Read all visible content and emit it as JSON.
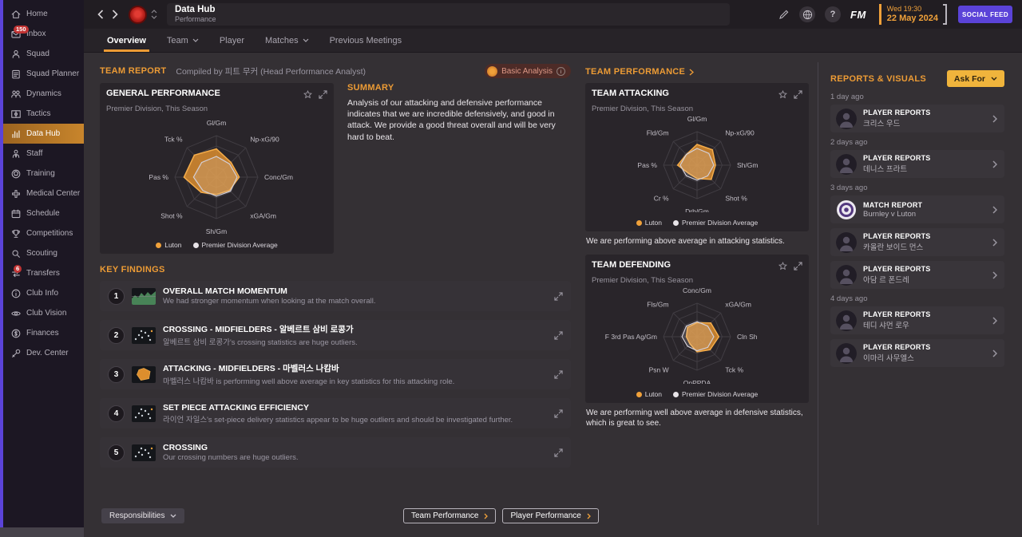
{
  "colors": {
    "accent_orange": "#ec9b35",
    "luton_series": "#f0a13a",
    "average_series": "#e8e4e8",
    "social_feed_purple": "#5b43d8",
    "ask_for_yellow": "#f0b43c",
    "sidebar_active": "#c8852c"
  },
  "sidebar": {
    "items": [
      {
        "label": "Home",
        "icon": "home"
      },
      {
        "label": "Inbox",
        "icon": "inbox",
        "badge": "150"
      },
      {
        "label": "Squad",
        "icon": "squad"
      },
      {
        "label": "Squad Planner",
        "icon": "planner"
      },
      {
        "label": "Dynamics",
        "icon": "dynamics"
      },
      {
        "label": "Tactics",
        "icon": "tactics"
      },
      {
        "label": "Data Hub",
        "icon": "datahub",
        "active": true
      },
      {
        "label": "Staff",
        "icon": "staff"
      },
      {
        "label": "Training",
        "icon": "training"
      },
      {
        "label": "Medical Center",
        "icon": "medical"
      },
      {
        "label": "Schedule",
        "icon": "schedule"
      },
      {
        "label": "Competitions",
        "icon": "competitions"
      },
      {
        "label": "Scouting",
        "icon": "scouting"
      },
      {
        "label": "Transfers",
        "icon": "transfers",
        "badge": "6"
      },
      {
        "label": "Club Info",
        "icon": "club-info"
      },
      {
        "label": "Club Vision",
        "icon": "club-vision"
      },
      {
        "label": "Finances",
        "icon": "finances"
      },
      {
        "label": "Dev. Center",
        "icon": "dev-center"
      }
    ]
  },
  "titlebar": {
    "title": "Data Hub",
    "subtitle": "Performance",
    "fm_label": "FM",
    "datetime_line1": "Wed 19:30",
    "datetime_line2": "22 May 2024",
    "social_feed_label": "SOCIAL FEED"
  },
  "tabs": [
    {
      "label": "Overview",
      "active": true
    },
    {
      "label": "Team",
      "dropdown": true
    },
    {
      "label": "Player"
    },
    {
      "label": "Matches",
      "dropdown": true
    },
    {
      "label": "Previous Meetings"
    }
  ],
  "report_header": {
    "title": "TEAM REPORT",
    "compiled_by": "Compiled by 피트 무커 (Head Performance Analyst)",
    "badge": "Basic Analysis"
  },
  "summary": {
    "title": "SUMMARY",
    "text": "Analysis of our attacking and defensive performance indicates that we are incredible defensively, and good in attack. We provide a good threat overall and will be very hard to beat."
  },
  "key_findings": {
    "title": "KEY FINDINGS",
    "items": [
      {
        "num": "1",
        "thumb": "momentum",
        "title": "OVERALL MATCH MOMENTUM",
        "desc": "We had stronger momentum when looking at the match overall."
      },
      {
        "num": "2",
        "thumb": "scatter",
        "title": "CROSSING - MIDFIELDERS - 알베르트 삼비 로콩가",
        "desc": "알베르트 삼비 로콩가's crossing statistics are huge outliers."
      },
      {
        "num": "3",
        "thumb": "radar",
        "title": "ATTACKING - MIDFIELDERS - 마벨러스 나캄바",
        "desc": "마벨러스 나캄바 is performing well above average in key statistics for this attacking role."
      },
      {
        "num": "4",
        "thumb": "scatter",
        "title": "SET PIECE ATTACKING EFFICIENCY",
        "desc": "라이언 자일스's set-piece delivery statistics appear to be huge outliers and should be investigated further."
      },
      {
        "num": "5",
        "thumb": "scatter",
        "title": "CROSSING",
        "desc": "Our crossing numbers are huge outliers."
      }
    ]
  },
  "team_performance": {
    "header": "TEAM PERFORMANCE",
    "attacking_note": "We are performing above average in attacking statistics.",
    "defending_note": "We are performing well above average in defensive statistics, which is great to see."
  },
  "chart_data": [
    {
      "type": "radar",
      "title": "GENERAL PERFORMANCE",
      "subtitle": "Premier Division, This Season",
      "axes": [
        "Gl/Gm",
        "Np-xG/90",
        "Conc/Gm",
        "xGA/Gm",
        "Sh/Gm",
        "Shot %",
        "Pas %",
        "Tck %"
      ],
      "scale": [
        0,
        1
      ],
      "grid": true,
      "legend_position": "bottom",
      "series": [
        {
          "name": "Luton",
          "color": "#f0a13a",
          "values": [
            0.68,
            0.5,
            0.55,
            0.45,
            0.42,
            0.52,
            0.78,
            0.75
          ]
        },
        {
          "name": "Premier Division Average",
          "color": "#e8e4e8",
          "values": [
            0.5,
            0.45,
            0.5,
            0.48,
            0.46,
            0.46,
            0.55,
            0.5
          ]
        }
      ]
    },
    {
      "type": "radar",
      "title": "TEAM ATTACKING",
      "subtitle": "Premier Division, This Season",
      "axes": [
        "Gl/Gm",
        "Np-xG/90",
        "Sh/Gm",
        "Shot %",
        "Drb/Gm",
        "Cr %",
        "Pas %",
        "Fld/Gm"
      ],
      "scale": [
        0,
        1
      ],
      "grid": true,
      "legend_position": "bottom",
      "series": [
        {
          "name": "Luton",
          "color": "#f0a13a",
          "values": [
            0.62,
            0.65,
            0.55,
            0.6,
            0.4,
            0.35,
            0.58,
            0.45
          ]
        },
        {
          "name": "Premier Division Average",
          "color": "#e8e4e8",
          "values": [
            0.5,
            0.5,
            0.5,
            0.45,
            0.45,
            0.45,
            0.5,
            0.45
          ]
        }
      ]
    },
    {
      "type": "radar",
      "title": "TEAM DEFENDING",
      "subtitle": "Premier Division, This Season",
      "axes": [
        "Conc/Gm",
        "xGA/Gm",
        "Cln Sh",
        "Tck %",
        "OpPPDA",
        "Psn W",
        "F 3rd Pas Ag/Gm",
        "Fls/Gm"
      ],
      "scale": [
        0,
        1
      ],
      "grid": true,
      "legend_position": "bottom",
      "series": [
        {
          "name": "Luton",
          "color": "#f0a13a",
          "values": [
            0.42,
            0.58,
            0.65,
            0.55,
            0.45,
            0.3,
            0.32,
            0.4
          ]
        },
        {
          "name": "Premier Division Average",
          "color": "#e8e4e8",
          "values": [
            0.45,
            0.45,
            0.5,
            0.45,
            0.42,
            0.4,
            0.45,
            0.45
          ]
        }
      ]
    }
  ],
  "reports_visuals": {
    "title": "REPORTS & VISUALS",
    "ask_for": "Ask For",
    "groups": [
      {
        "time": "1 day ago",
        "cards": [
          {
            "type": "PLAYER REPORTS",
            "name": "크리스 우드",
            "icon": "avatar"
          }
        ]
      },
      {
        "time": "2 days ago",
        "cards": [
          {
            "type": "PLAYER REPORTS",
            "name": "데니스 프라트",
            "icon": "avatar"
          }
        ]
      },
      {
        "time": "3 days ago",
        "cards": [
          {
            "type": "MATCH REPORT",
            "name": "Burnley v Luton",
            "icon": "badge"
          },
          {
            "type": "PLAYER REPORTS",
            "name": "카올란 보이드 먼스",
            "icon": "avatar"
          },
          {
            "type": "PLAYER REPORTS",
            "name": "아담 르 폰드레",
            "icon": "avatar"
          }
        ]
      },
      {
        "time": "4 days ago",
        "cards": [
          {
            "type": "PLAYER REPORTS",
            "name": "테디 샤먼 로우",
            "icon": "avatar"
          },
          {
            "type": "PLAYER REPORTS",
            "name": "이마리 사무엘스",
            "icon": "avatar"
          }
        ]
      }
    ]
  },
  "footer": {
    "responsibilities": "Responsibilities",
    "team_performance": "Team Performance",
    "player_performance": "Player Performance"
  }
}
